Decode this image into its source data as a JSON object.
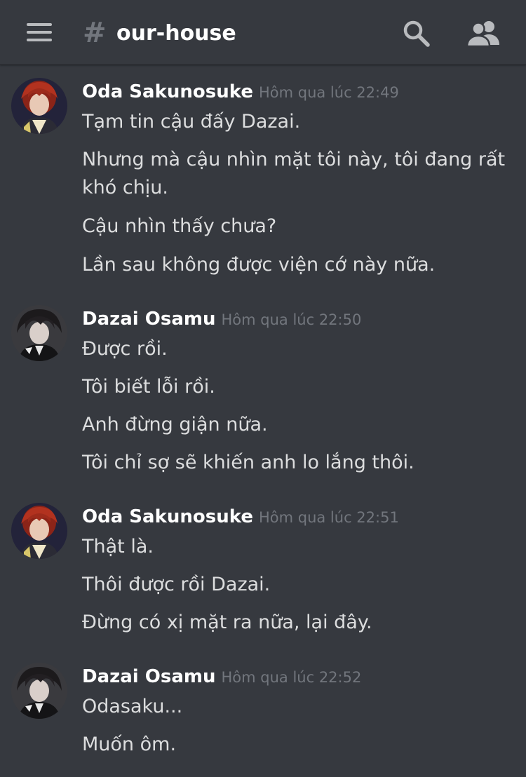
{
  "header": {
    "channel_hash": "#",
    "channel_name": "our-house",
    "icons": [
      "menu-icon",
      "search-icon",
      "members-icon"
    ]
  },
  "messages": [
    {
      "author": "Oda Sakunosuke",
      "timestamp": "Hôm qua lúc 22:49",
      "avatar": "oda-avatar",
      "lines": [
        "Tạm tin cậu đấy Dazai.",
        "Nhưng mà cậu nhìn mặt tôi này, tôi đang rất khó chịu.",
        "Cậu nhìn thấy chưa?",
        "Lần sau không được viện cớ này nữa."
      ]
    },
    {
      "author": "Dazai Osamu",
      "timestamp": "Hôm qua lúc 22:50",
      "avatar": "dazai-avatar",
      "lines": [
        "Được rồi.",
        "Tôi biết lỗi rồi.",
        "Anh đừng giận nữa.",
        "Tôi chỉ sợ sẽ khiến anh lo lắng thôi."
      ]
    },
    {
      "author": "Oda Sakunosuke",
      "timestamp": "Hôm qua lúc 22:51",
      "avatar": "oda-avatar",
      "lines": [
        "Thật là.",
        "Thôi được rồi Dazai.",
        "Đừng có xị mặt ra nữa, lại đây."
      ]
    },
    {
      "author": "Dazai Osamu",
      "timestamp": "Hôm qua lúc 22:52",
      "avatar": "dazai-avatar",
      "lines": [
        "Odasaku...",
        "Muốn ôm."
      ]
    }
  ]
}
